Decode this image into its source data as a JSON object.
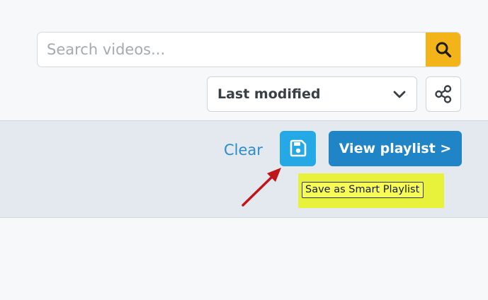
{
  "search": {
    "placeholder": "Search videos...",
    "value": ""
  },
  "sort": {
    "selected": "Last modified"
  },
  "toolbar": {
    "clear_label": "Clear",
    "view_playlist_label": "View playlist >",
    "save_tooltip": "Save as Smart Playlist"
  },
  "icons": {
    "search": "search-icon",
    "chevron": "chevron-down-icon",
    "share": "share-icon",
    "save": "floppy-disk-icon"
  },
  "colors": {
    "search_button": "#f3b41a",
    "save_button": "#25a9e6",
    "view_button": "#1f85c6",
    "clear_link": "#2b8ec9",
    "tooltip_highlight": "#e9f23a",
    "arrow": "#c0151b"
  }
}
